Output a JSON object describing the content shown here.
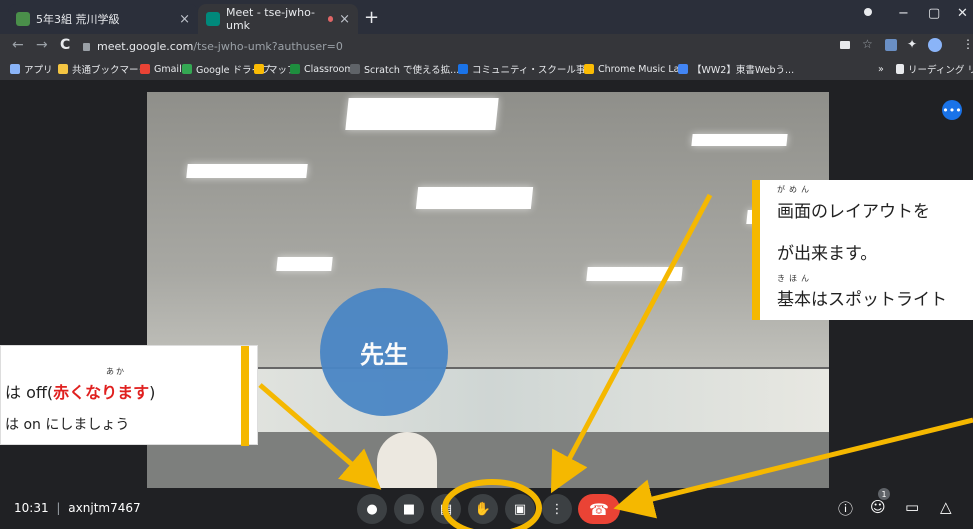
{
  "browser": {
    "tabs": [
      {
        "label": "5年3組 荒川学級",
        "close": "×"
      },
      {
        "label": "Meet - tse-jwho-umk",
        "close": "×"
      }
    ],
    "new_tab": "+",
    "window_controls": [
      "−",
      "▢",
      "✕"
    ],
    "nav": {
      "back": "←",
      "forward": "→",
      "reload": "C"
    },
    "url": {
      "host": "meet.google.com",
      "path": "/tse-jwho-umk?authuser=0"
    },
    "bookmarks": [
      "アプリ",
      "共通ブックマーク",
      "Gmail",
      "Google ドライブ",
      "マップ",
      "Classroom",
      "Scratch で使える拡...",
      "コミュニティ・スクール事...",
      "Chrome Music Lab",
      "【WW2】東書Webう...",
      "»",
      "リーディング リスト"
    ]
  },
  "meet": {
    "time": "10:31",
    "separator": "|",
    "meeting_code": "axnjtm7467",
    "participants_badge": "1",
    "more_options": "•••"
  },
  "annotations": {
    "circle_label": "先生",
    "left_note": {
      "line1_prefix": "は off(",
      "line1_ruby": "あか",
      "line1_red": "赤くなります",
      "line1_suffix": ")",
      "line2": "は on にしましょう"
    },
    "right_note": {
      "ruby1": "がめん",
      "line1": "画面のレイアウトを",
      "line2": "が出来ます。",
      "ruby3": "きほん",
      "line3": "基本はスポットライト"
    }
  },
  "colors": {
    "accent_yellow": "#f5b800",
    "end_call_red": "#ea4335",
    "highlight_red": "#e0201f",
    "circle_blue": "#4a86c5"
  }
}
